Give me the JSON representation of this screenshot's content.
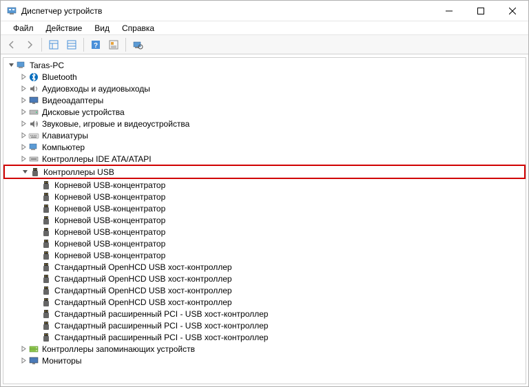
{
  "window": {
    "title": "Диспетчер устройств"
  },
  "menu": {
    "file": "Файл",
    "action": "Действие",
    "view": "Вид",
    "help": "Справка"
  },
  "tree": {
    "root": "Taras-PC",
    "categories": [
      {
        "label": "Bluetooth",
        "icon": "bluetooth",
        "expanded": false
      },
      {
        "label": "Аудиовходы и аудиовыходы",
        "icon": "audio",
        "expanded": false
      },
      {
        "label": "Видеоадаптеры",
        "icon": "display",
        "expanded": false
      },
      {
        "label": "Дисковые устройства",
        "icon": "disk",
        "expanded": false
      },
      {
        "label": "Звуковые, игровые и видеоустройства",
        "icon": "sound",
        "expanded": false
      },
      {
        "label": "Клавиатуры",
        "icon": "keyboard",
        "expanded": false
      },
      {
        "label": "Компьютер",
        "icon": "computer",
        "expanded": false
      },
      {
        "label": "Контроллеры IDE ATA/ATAPI",
        "icon": "ide",
        "expanded": false
      },
      {
        "label": "Контроллеры USB",
        "icon": "usb",
        "expanded": true,
        "highlighted": true,
        "children": [
          "Корневой USB-концентратор",
          "Корневой USB-концентратор",
          "Корневой USB-концентратор",
          "Корневой USB-концентратор",
          "Корневой USB-концентратор",
          "Корневой USB-концентратор",
          "Корневой USB-концентратор",
          "Стандартный OpenHCD USB хост-контроллер",
          "Стандартный OpenHCD USB хост-контроллер",
          "Стандартный OpenHCD USB хост-контроллер",
          "Стандартный OpenHCD USB хост-контроллер",
          "Стандартный расширенный PCI - USB хост-контроллер",
          "Стандартный расширенный PCI - USB хост-контроллер",
          "Стандартный расширенный PCI - USB хост-контроллер"
        ]
      },
      {
        "label": "Контроллеры запоминающих устройств",
        "icon": "storage",
        "expanded": false
      },
      {
        "label": "Мониторы",
        "icon": "monitor",
        "expanded": false,
        "cut": true
      }
    ]
  }
}
